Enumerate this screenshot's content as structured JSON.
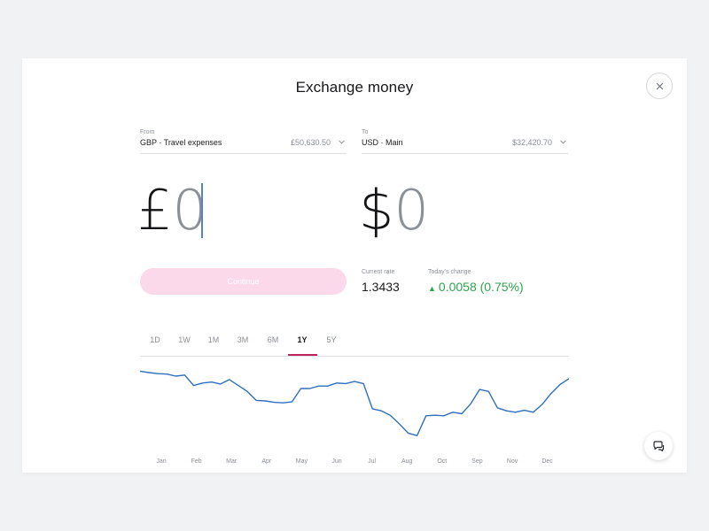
{
  "title": "Exchange money",
  "from": {
    "label": "From",
    "account": "GBP · Travel expenses",
    "balance": "£50,630.50",
    "currency_symbol": "£",
    "amount": "0"
  },
  "to": {
    "label": "To",
    "account": "USD · Main",
    "balance": "$32,420.70",
    "currency_symbol": "$",
    "amount": "0"
  },
  "continue_label": "Continue",
  "current_rate": {
    "label": "Current rate",
    "value": "1.3433"
  },
  "todays_change": {
    "label": "Today's change",
    "arrow": "▲",
    "value": "0.0058 (0.75%)"
  },
  "tabs": [
    "1D",
    "1W",
    "1M",
    "3M",
    "6M",
    "1Y",
    "5Y"
  ],
  "active_tab": "1Y",
  "colors": {
    "accent": "#c0245c",
    "continue_bg": "#fbd8ea",
    "positive": "#2ea44f",
    "line": "#2f6fc1"
  },
  "chart_data": {
    "type": "line",
    "categories": [
      "Jan",
      "Feb",
      "Mar",
      "Apr",
      "May",
      "Jun",
      "Jul",
      "Aug",
      "Oct",
      "Sep",
      "Nov",
      "Dec"
    ],
    "series": [
      {
        "values": [
          1.434,
          1.431,
          1.429,
          1.428,
          1.424,
          1.426,
          1.405,
          1.41,
          1.412,
          1.408,
          1.417,
          1.405,
          1.393,
          1.375,
          1.374,
          1.371,
          1.37,
          1.372,
          1.399,
          1.399,
          1.404,
          1.404,
          1.41,
          1.409,
          1.413,
          1.409,
          1.358,
          1.354,
          1.345,
          1.328,
          1.309,
          1.304,
          1.344,
          1.345,
          1.344,
          1.351,
          1.348,
          1.368,
          1.397,
          1.393,
          1.36,
          1.354,
          1.351,
          1.355,
          1.351,
          1.367,
          1.389,
          1.407,
          1.419
        ]
      }
    ],
    "ylim": [
      1.29,
      1.44
    ],
    "grid": false
  }
}
